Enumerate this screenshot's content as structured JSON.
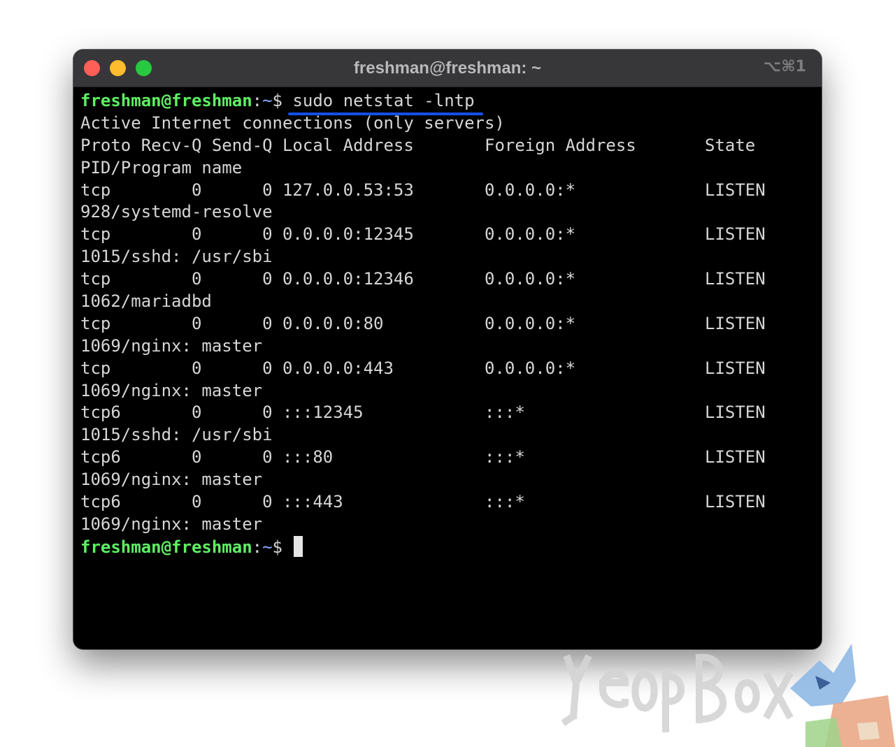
{
  "window": {
    "title": "freshman@freshman: ~",
    "shortcut": "⌥⌘1"
  },
  "terminal": {
    "prompt_user": "freshman@freshman",
    "prompt_sep": ":",
    "prompt_path": "~",
    "prompt_symbol": "$ ",
    "command": "sudo netstat -lntp",
    "lines": [
      {
        "c1": "Active Internet connections (only servers)",
        "c2": "",
        "c3": ""
      },
      {
        "c1": "Proto Recv-Q Send-Q Local Address",
        "c2": "Foreign Address",
        "c3": "State"
      },
      {
        "c1": "PID/Program name",
        "c2": "",
        "c3": ""
      },
      {
        "c1": "tcp        0      0 127.0.0.53:53",
        "c2": "0.0.0.0:*",
        "c3": "LISTEN"
      },
      {
        "c1": "928/systemd-resolve",
        "c2": "",
        "c3": ""
      },
      {
        "c1": "tcp        0      0 0.0.0.0:12345",
        "c2": "0.0.0.0:*",
        "c3": "LISTEN"
      },
      {
        "c1": "1015/sshd: /usr/sbi",
        "c2": "",
        "c3": ""
      },
      {
        "c1": "tcp        0      0 0.0.0.0:12346",
        "c2": "0.0.0.0:*",
        "c3": "LISTEN"
      },
      {
        "c1": "1062/mariadbd",
        "c2": "",
        "c3": ""
      },
      {
        "c1": "tcp        0      0 0.0.0.0:80",
        "c2": "0.0.0.0:*",
        "c3": "LISTEN"
      },
      {
        "c1": "1069/nginx: master",
        "c2": "",
        "c3": ""
      },
      {
        "c1": "tcp        0      0 0.0.0.0:443",
        "c2": "0.0.0.0:*",
        "c3": "LISTEN"
      },
      {
        "c1": "1069/nginx: master",
        "c2": "",
        "c3": ""
      },
      {
        "c1": "tcp6       0      0 :::12345",
        "c2": ":::*",
        "c3": "LISTEN"
      },
      {
        "c1": "1015/sshd: /usr/sbi",
        "c2": "",
        "c3": ""
      },
      {
        "c1": "tcp6       0      0 :::80",
        "c2": ":::*",
        "c3": "LISTEN"
      },
      {
        "c1": "1069/nginx: master",
        "c2": "",
        "c3": ""
      },
      {
        "c1": "tcp6       0      0 :::443",
        "c2": ":::*",
        "c3": "LISTEN"
      },
      {
        "c1": "1069/nginx: master",
        "c2": "",
        "c3": ""
      }
    ]
  },
  "colors": {
    "prompt_user": "#5ef162",
    "prompt_path": "#8aa8ff",
    "command_underline": "#1550e6",
    "terminal_bg": "#000000",
    "titlebar_bg": "#37373a"
  },
  "watermark": {
    "text": "YeopBox",
    "icon": "fox-mascot-icon"
  }
}
